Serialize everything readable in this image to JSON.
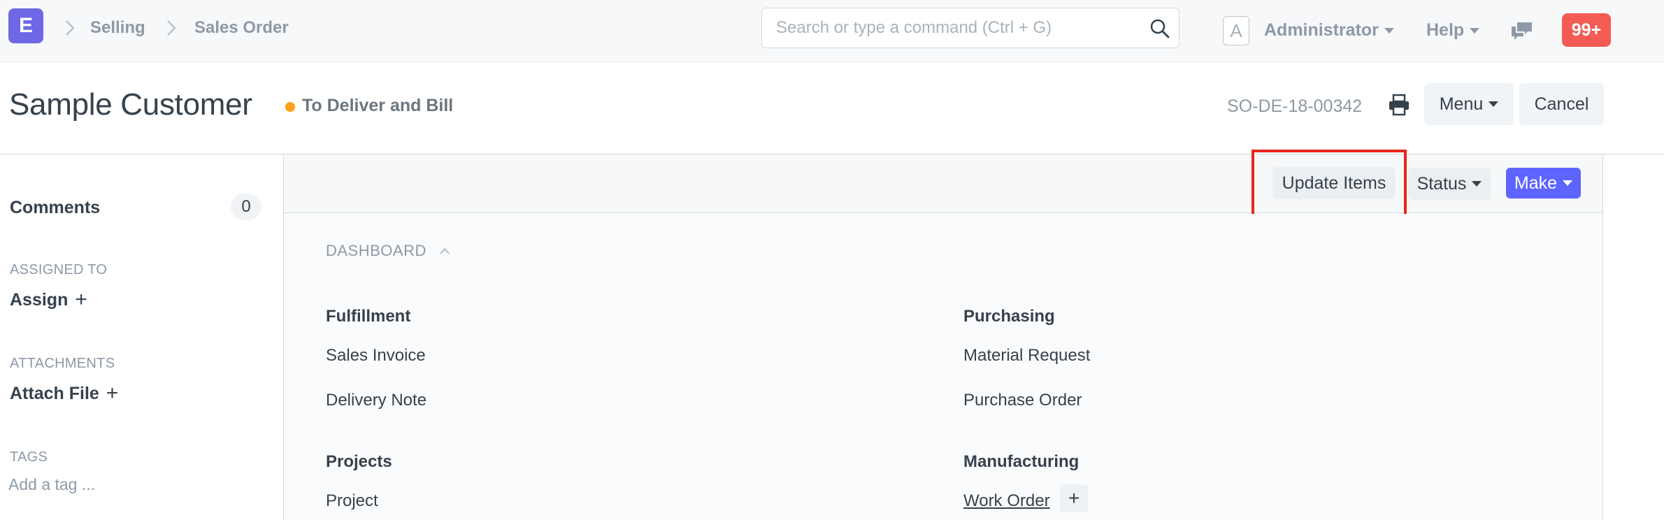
{
  "navbar": {
    "logo_letter": "E",
    "breadcrumbs": [
      "Selling",
      "Sales Order"
    ],
    "search_placeholder": "Search or type a command (Ctrl + G)",
    "avatar_letter": "A",
    "user_label": "Administrator",
    "help_label": "Help",
    "notification_count": "99+"
  },
  "page_head": {
    "title": "Sample Customer",
    "status": "To Deliver and Bill",
    "status_color": "#ff9f1a",
    "doc_name": "SO-DE-18-00342",
    "menu_label": "Menu",
    "cancel_label": "Cancel"
  },
  "sidebar": {
    "comments_label": "Comments",
    "comments_count": "0",
    "assigned_caption": "ASSIGNED TO",
    "assign_label": "Assign",
    "attachments_caption": "ATTACHMENTS",
    "attach_label": "Attach File",
    "tags_caption": "TAGS",
    "tag_placeholder": "Add a tag ..."
  },
  "toolbar": {
    "update_items_label": "Update Items",
    "status_label": "Status",
    "make_label": "Make"
  },
  "dashboard": {
    "heading": "DASHBOARD",
    "groups": [
      {
        "title": "Fulfillment",
        "items": [
          "Sales Invoice",
          "Delivery Note"
        ]
      },
      {
        "title": "Purchasing",
        "items": [
          "Material Request",
          "Purchase Order"
        ]
      },
      {
        "title": "Projects",
        "items": [
          "Project"
        ]
      },
      {
        "title": "Manufacturing",
        "items": [
          "Work Order"
        ]
      }
    ]
  },
  "colors": {
    "primary": "#5e64ff",
    "logo": "#6e68e6",
    "notification": "#f25c54",
    "highlight_box": "#e8271c"
  }
}
